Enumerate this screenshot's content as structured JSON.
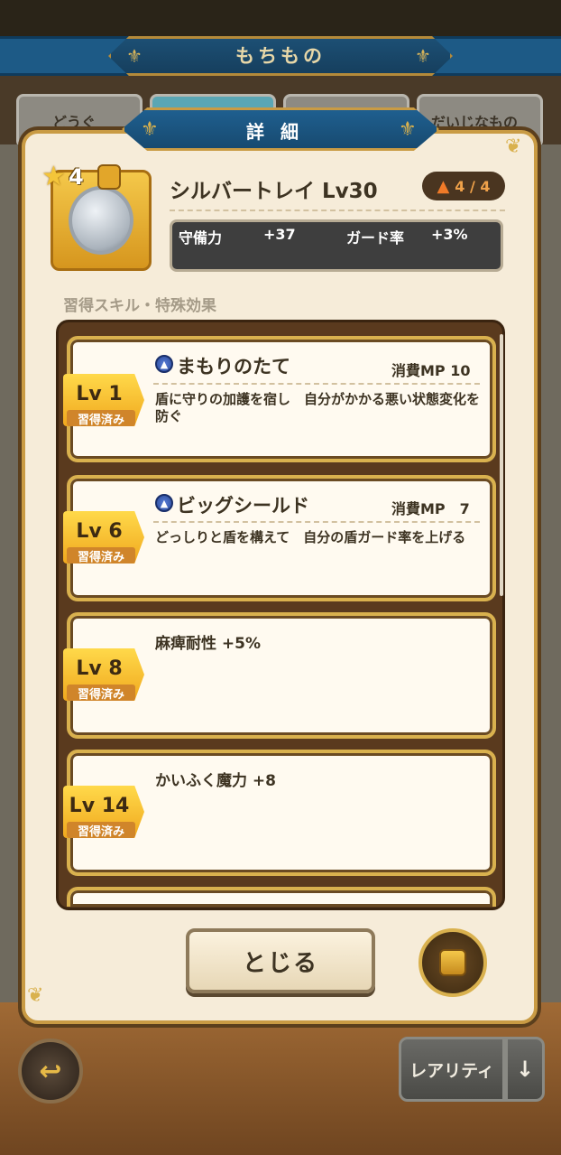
{
  "header": {
    "title": "もちもの"
  },
  "tabs": [
    "どうぐ",
    "",
    "",
    "だいじなもの"
  ],
  "dialog": {
    "title": "詳細"
  },
  "item": {
    "rarity_stars": "4",
    "name": "シルバートレイ Lv30",
    "rank": "4 / 4",
    "stats": [
      {
        "label": "守備力",
        "value": "+37"
      },
      {
        "label": "ガード率",
        "value": "+3%"
      }
    ]
  },
  "section_label": "習得スキル・特殊効果",
  "skills": [
    {
      "level": "Lv 1",
      "status": "習得済み",
      "name": "まもりのたて",
      "mp": "消費MP 10",
      "desc": "盾に守りの加護を宿し　自分がかかる悪い状態変化を防ぐ"
    },
    {
      "level": "Lv 6",
      "status": "習得済み",
      "name": "ビッグシールド",
      "mp": "消費MP　7",
      "desc": "どっしりと盾を構えて　自分の盾ガード率を上げる"
    },
    {
      "level": "Lv 8",
      "status": "習得済み",
      "name": "麻痺耐性 +5%"
    },
    {
      "level": "Lv 14",
      "status": "習得済み",
      "name": "かいふく魔力 +8"
    }
  ],
  "buttons": {
    "close": "とじる",
    "sort": "レアリティ",
    "sort_arrow": "↓",
    "back": "↩"
  },
  "icons": {
    "lock": "lock-icon",
    "star": "star-icon",
    "skill": "skill-orb-icon"
  }
}
